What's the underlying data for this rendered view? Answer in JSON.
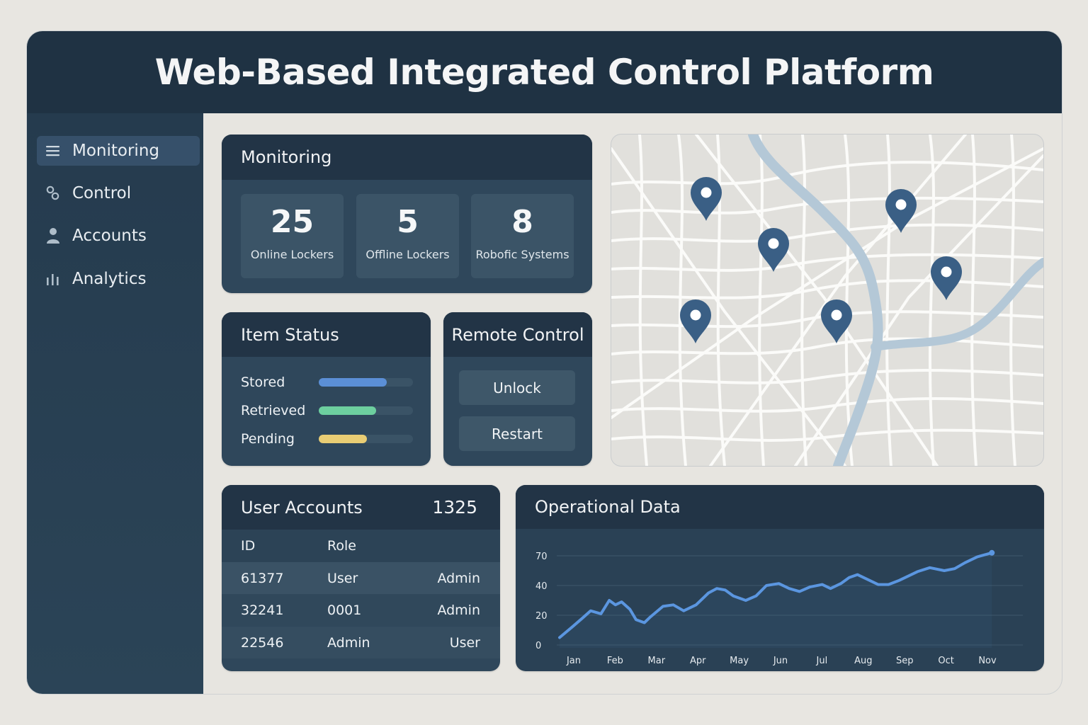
{
  "app": {
    "title": "Web-Based Integrated Control Platform"
  },
  "sidebar": {
    "items": [
      {
        "label": "Monitoring",
        "icon": "menu-icon",
        "active": true
      },
      {
        "label": "Control",
        "icon": "link-icon",
        "active": false
      },
      {
        "label": "Accounts",
        "icon": "user-icon",
        "active": false
      },
      {
        "label": "Analytics",
        "icon": "bar-chart-icon",
        "active": false
      }
    ]
  },
  "monitoring": {
    "title": "Monitoring",
    "stats": [
      {
        "value": "25",
        "label": "Online Lockers"
      },
      {
        "value": "5",
        "label": "Offline Lockers"
      },
      {
        "value": "8",
        "label": "Robofic Systems"
      }
    ]
  },
  "item_status": {
    "title": "Item Status",
    "rows": [
      {
        "label": "Stored",
        "level": 0.72,
        "color": "#5b8fd6"
      },
      {
        "label": "Retrieved",
        "level": 0.61,
        "color": "#6dcf9f"
      },
      {
        "label": "Pending",
        "level": 0.51,
        "color": "#e9cd74"
      }
    ]
  },
  "remote_control": {
    "title": "Remote Control",
    "unlock_label": "Unlock",
    "restart_label": "Restart"
  },
  "map": {
    "pin_icon": "map-pin-icon",
    "pin_color": "#3a5f85",
    "river_color": "#b4c8d7"
  },
  "accounts": {
    "title": "User Accounts",
    "count": "1325",
    "columns": [
      "ID",
      "Role"
    ],
    "rows": [
      [
        "61377",
        "User",
        "Admin"
      ],
      [
        "32241",
        "0001",
        "Admin"
      ],
      [
        "22546",
        "Admin",
        "User"
      ]
    ]
  },
  "operational": {
    "title": "Operational Data"
  },
  "chart_data": {
    "type": "line",
    "title": "",
    "xlabel": "",
    "ylabel": "",
    "categories": [
      "Jan",
      "Feb",
      "Mar",
      "Apr",
      "May",
      "Jun",
      "Jul",
      "Aug",
      "Sep",
      "Oct",
      "Nov"
    ],
    "y_ticks": [
      0,
      20,
      40,
      70
    ],
    "grid": true,
    "color": "#5b96e0",
    "series": [
      {
        "x": [
          0,
          0.3,
          0.55,
          0.75,
          1.0,
          1.2,
          1.35,
          1.5,
          1.7,
          1.85,
          2.05,
          2.2,
          2.5,
          2.75,
          3.0,
          3.3,
          3.6,
          3.8,
          4.0,
          4.2,
          4.5,
          4.75,
          5.0,
          5.3,
          5.55,
          5.8,
          6.05,
          6.35,
          6.55,
          6.8,
          7.0,
          7.2,
          7.45,
          7.7,
          7.95,
          8.2,
          8.4,
          8.65,
          8.95,
          9.3,
          9.55,
          9.8,
          10.1,
          10.45
        ],
        "y": [
          5,
          12,
          18,
          23,
          21,
          30,
          27,
          29,
          24,
          17,
          15,
          19,
          26,
          27,
          23,
          27,
          35,
          38,
          37,
          33,
          30,
          33,
          40,
          42,
          38,
          36,
          39,
          41,
          38,
          42,
          48,
          51,
          46,
          41,
          41,
          45,
          49,
          54,
          58,
          55,
          57,
          63,
          69,
          73
        ]
      }
    ]
  }
}
